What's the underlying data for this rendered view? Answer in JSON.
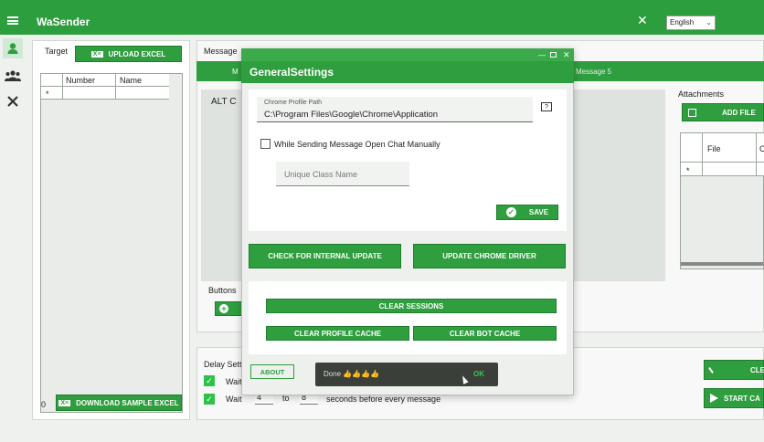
{
  "app": {
    "title": "WaSender",
    "language": "English"
  },
  "nav": {
    "icons": [
      "person-icon",
      "group-icon",
      "tools-icon"
    ]
  },
  "target": {
    "label": "Target",
    "upload_label": "UPLOAD EXCEL",
    "col_number": "Number",
    "col_name": "Name",
    "row_marker": "*",
    "count": "0",
    "download_label": "DOWNLOAD SAMPLE EXCEL"
  },
  "message": {
    "label": "Message",
    "tab_first": "M",
    "tab_last": "Message 5",
    "text_preview": "ALT C",
    "buttons_label": "Buttons"
  },
  "attachments": {
    "label": "Attachments",
    "add_label": "ADD FILE",
    "col_file": "File",
    "col_c": "C",
    "row_marker": "*"
  },
  "delay": {
    "label": "Delay Settin",
    "row1_wait": "Wait",
    "row2_wait": "Wait",
    "from": "4",
    "to_label": "to",
    "to": "8",
    "suffix": "seconds before every message"
  },
  "right_buttons": {
    "clear": "CLE",
    "start": "START CA"
  },
  "dialog": {
    "title": "GeneralSettings",
    "chrome_path_label": "Chrome Profile Path",
    "chrome_path_value": "C:\\Program Files\\Google\\Chrome\\Application",
    "help": "?",
    "manual_chat_label": "While Sending Message Open Chat Manually",
    "class_placeholder": "Unique Class Name",
    "save_label": "SAVE",
    "check_update_label": "CHECK FOR INTERNAL UPDATE",
    "update_driver_label": "UPDATE CHROME DRIVER",
    "clear_sessions_label": "CLEAR SESSIONS",
    "clear_profile_label": "CLEAR PROFILE CACHE",
    "clear_bot_label": "CLEAR BOT CACHE",
    "about_label": "ABOUT"
  },
  "toast": {
    "text": "Done 👍👍👍👍",
    "ok": "OK"
  },
  "colors": {
    "accent": "#2e9e3e",
    "titlebar": "#2c9e3d"
  }
}
